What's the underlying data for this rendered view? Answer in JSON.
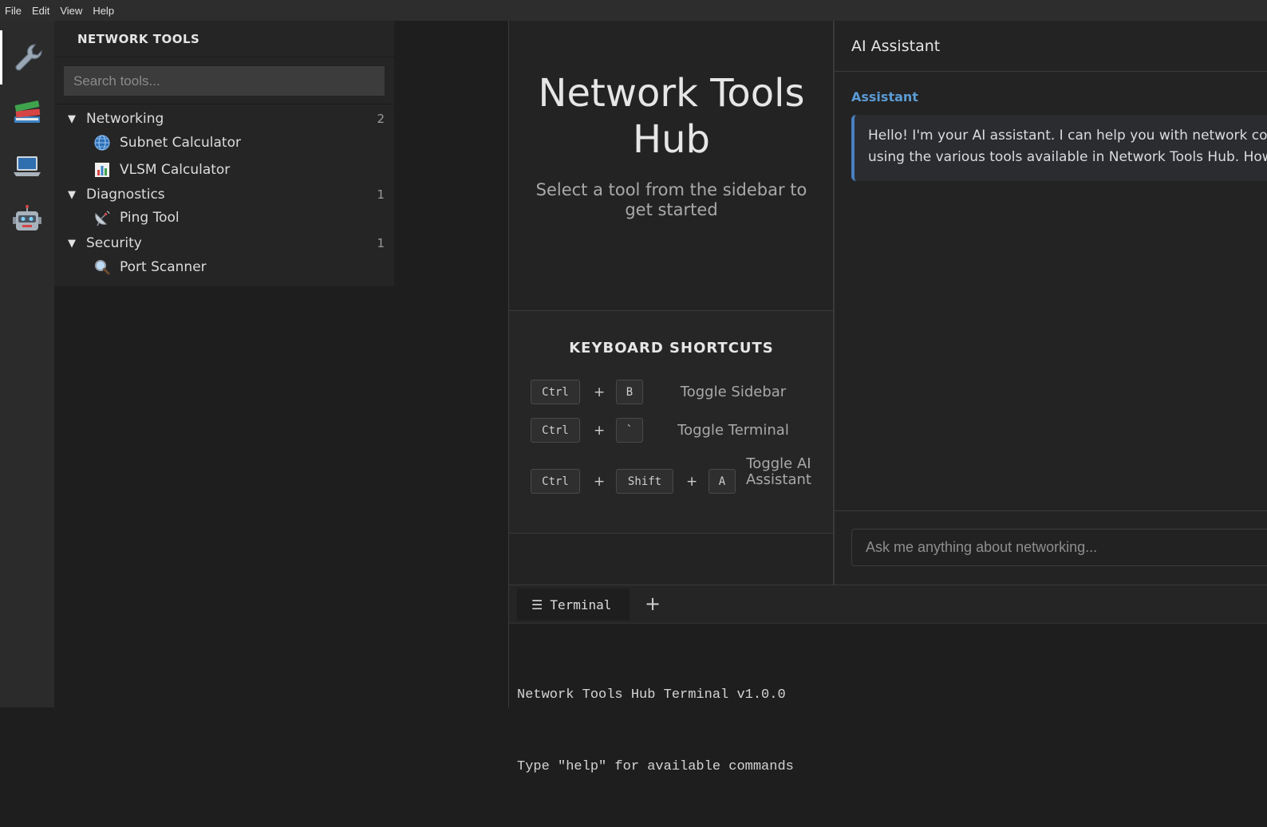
{
  "menubar": {
    "items": [
      "File",
      "Edit",
      "View",
      "Help"
    ]
  },
  "activity_bar": {
    "items": [
      "wrench-icon",
      "books-icon",
      "laptop-icon",
      "robot-icon"
    ]
  },
  "sidebar": {
    "title": "NETWORK TOOLS",
    "search": {
      "placeholder": "Search tools...",
      "value": ""
    },
    "categories": [
      {
        "label": "Networking",
        "count": "2",
        "tools": [
          {
            "label": "Subnet Calculator",
            "icon": "globe-icon"
          },
          {
            "label": "VLSM Calculator",
            "icon": "bar-chart-icon"
          }
        ]
      },
      {
        "label": "Diagnostics",
        "count": "1",
        "tools": [
          {
            "label": "Ping Tool",
            "icon": "satellite-antenna-icon"
          }
        ]
      },
      {
        "label": "Security",
        "count": "1",
        "tools": [
          {
            "label": "Port Scanner",
            "icon": "magnifier-icon"
          }
        ]
      }
    ]
  },
  "welcome": {
    "title": "Network Tools Hub",
    "subtitle": "Select a tool from the sidebar to get started"
  },
  "shortcuts": {
    "title": "KEYBOARD SHORTCUTS",
    "items": [
      {
        "keys": [
          "Ctrl",
          "B"
        ],
        "label": "Toggle Sidebar"
      },
      {
        "keys": [
          "Ctrl",
          "`"
        ],
        "label": "Toggle Terminal"
      },
      {
        "keys": [
          "Ctrl",
          "Shift",
          "A"
        ],
        "label": "Toggle AI Assistant"
      }
    ],
    "plus": "+"
  },
  "ai": {
    "title": "AI Assistant",
    "role": "Assistant",
    "message_line1": "Hello! I'm your AI assistant. I can help you with network configurations, troubleshooting, and",
    "message_line2": "using the various tools available in Network Tools Hub. How can I help you today?",
    "input_placeholder": "Ask me anything about networking..."
  },
  "terminal": {
    "tab_label": "Terminal",
    "tab_icon": "hamburger-icon",
    "add_label": "+",
    "lines": [
      "Network Tools Hub Terminal v1.0.0",
      "Type \"help\" for available commands"
    ]
  },
  "colors": {
    "accent": "#5b9bd5",
    "message_border": "#4a7fc1",
    "background": "#1e1e1e"
  }
}
